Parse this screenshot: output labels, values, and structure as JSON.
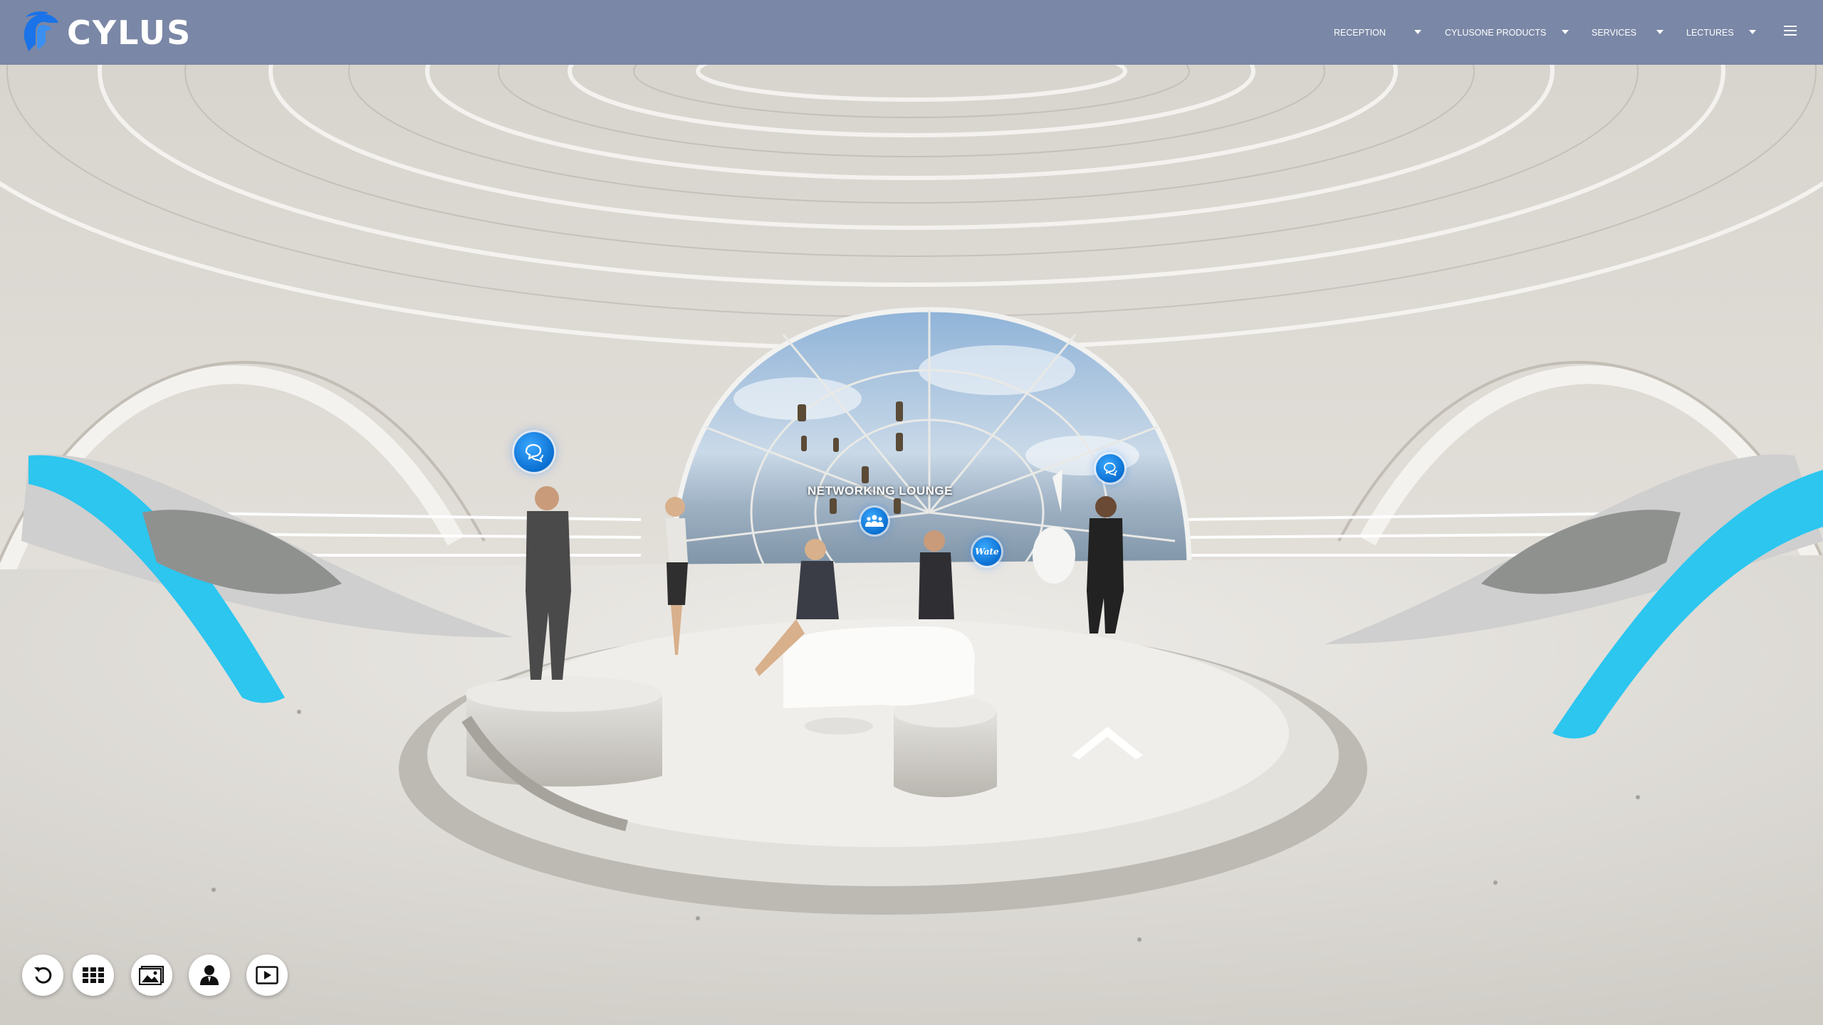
{
  "brand": {
    "name": "CYLUS"
  },
  "nav": {
    "items": [
      {
        "label": "RECEPTION"
      },
      {
        "label": "CYLUSONE PRODUCTS"
      },
      {
        "label": "SERVICES"
      },
      {
        "label": "LECTURES"
      }
    ],
    "menu_icon": "hamburger-menu-icon"
  },
  "scene": {
    "zone_label": "NETWORKING LOUNGE",
    "hotspots": [
      {
        "icon": "chat-bubbles-icon"
      },
      {
        "icon": "chat-bubbles-icon"
      },
      {
        "icon": "group-people-icon"
      },
      {
        "icon": "wate-logo-icon"
      },
      {
        "icon": "chevron-up-arrow-icon"
      }
    ],
    "wate_text": "Wate"
  },
  "toolbar": {
    "buttons": [
      {
        "icon": "reset-rotate-icon"
      },
      {
        "icon": "grid-menu-icon"
      },
      {
        "icon": "gallery-image-icon"
      },
      {
        "icon": "user-profile-icon"
      },
      {
        "icon": "video-play-icon"
      }
    ]
  },
  "colors": {
    "header": "#7a87a6",
    "accent_blue": "#1f8ef0",
    "accent_cyan": "#3fd4f5",
    "floor": "#dcd9d3"
  }
}
